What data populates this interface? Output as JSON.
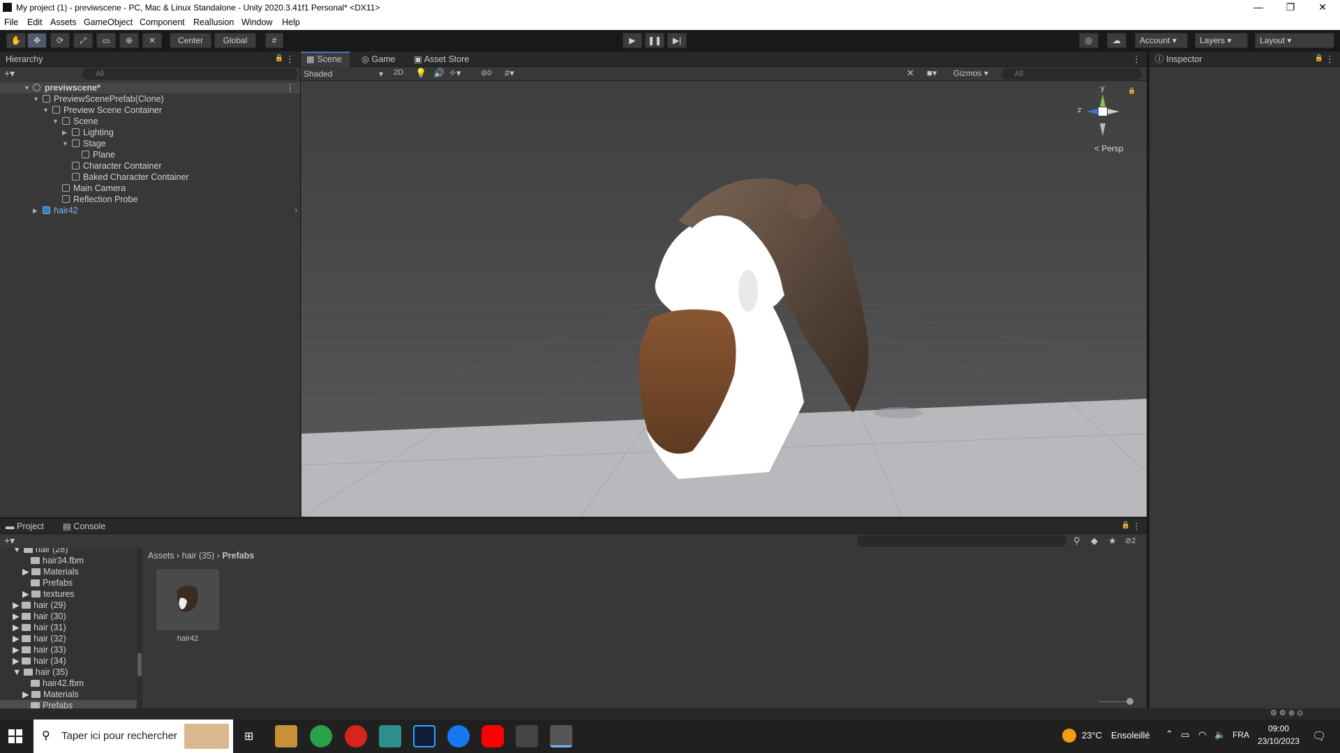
{
  "window": {
    "title": "My project (1) - previwscene - PC, Mac & Linux Standalone - Unity 2020.3.41f1 Personal* <DX11>",
    "minimize": "—",
    "maximize": "❐",
    "close": "✕"
  },
  "menu": [
    "File",
    "Edit",
    "Assets",
    "GameObject",
    "Component",
    "Reallusion",
    "Window",
    "Help"
  ],
  "toolbar": {
    "pivot": "Center",
    "space": "Global",
    "account": "Account",
    "layers": "Layers",
    "layout": "Layout"
  },
  "hierarchy": {
    "tab": "Hierarchy",
    "search_placeholder": "All",
    "rows": [
      {
        "label": "previwscene*",
        "bold": true
      },
      {
        "label": "PreviewScenePrefab(Clone)"
      },
      {
        "label": "Preview Scene Container"
      },
      {
        "label": "Scene"
      },
      {
        "label": "Lighting"
      },
      {
        "label": "Stage"
      },
      {
        "label": "Plane"
      },
      {
        "label": "Character Container"
      },
      {
        "label": "Baked Character Container"
      },
      {
        "label": "Main Camera"
      },
      {
        "label": "Reflection Probe"
      },
      {
        "label": "hair42",
        "prefab": true
      }
    ]
  },
  "scene": {
    "tabs": [
      "Scene",
      "Game",
      "Asset Store"
    ],
    "shading": "Shaded",
    "mode2d": "2D",
    "hidden_count": "0",
    "gizmos": "Gizmos",
    "search_placeholder": "All",
    "persp_label": "< Persp",
    "axis_y": "y",
    "axis_z": "z"
  },
  "inspector": {
    "tab": "Inspector"
  },
  "project": {
    "tabs": [
      "Project",
      "Console"
    ],
    "hidden_count": "2",
    "breadcrumb": [
      "Assets",
      "hair (35)",
      "Prefabs"
    ],
    "tree": [
      {
        "label": "hair (28)",
        "indent": 1,
        "open": true
      },
      {
        "label": "hair34.fbm",
        "indent": 2
      },
      {
        "label": "Materials",
        "indent": 2,
        "arrow": true
      },
      {
        "label": "Prefabs",
        "indent": 2
      },
      {
        "label": "textures",
        "indent": 2,
        "arrow": true
      },
      {
        "label": "hair (29)",
        "indent": 1,
        "arrow": true
      },
      {
        "label": "hair (30)",
        "indent": 1,
        "arrow": true
      },
      {
        "label": "hair (31)",
        "indent": 1,
        "arrow": true
      },
      {
        "label": "hair (32)",
        "indent": 1,
        "arrow": true
      },
      {
        "label": "hair (33)",
        "indent": 1,
        "arrow": true
      },
      {
        "label": "hair (34)",
        "indent": 1,
        "arrow": true
      },
      {
        "label": "hair (35)",
        "indent": 1,
        "open": true
      },
      {
        "label": "hair42.fbm",
        "indent": 2
      },
      {
        "label": "Materials",
        "indent": 2,
        "arrow": true
      },
      {
        "label": "Prefabs",
        "indent": 2,
        "selected": true
      }
    ],
    "asset": {
      "label": "hair42"
    }
  },
  "taskbar": {
    "search_placeholder": "Taper ici pour rechercher",
    "weather_temp": "23°C",
    "weather_text": "Ensoleillé",
    "lang": "FRA",
    "time": "09:00",
    "date": "23/10/2023"
  },
  "colors": {
    "accent": "#3a79bb",
    "panel": "#383838",
    "viewport": "#474747"
  }
}
